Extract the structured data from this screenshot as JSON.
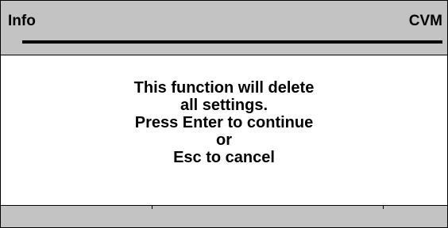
{
  "header": {
    "title": "Info",
    "device": "CVM"
  },
  "dialog": {
    "lines": [
      "This function will delete",
      "all settings.",
      "Press Enter to continue",
      "or",
      "Esc to cancel"
    ]
  },
  "colors": {
    "bar_background": "#c3c3c3",
    "content_background": "#ffffff",
    "text": "#000000"
  }
}
